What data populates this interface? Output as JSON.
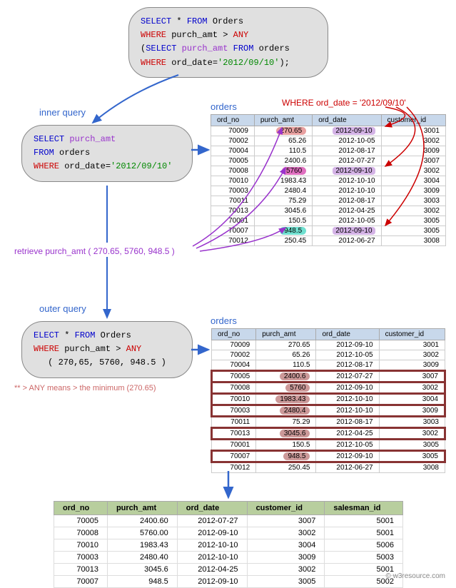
{
  "main_query": {
    "l1a": "SELECT",
    "l1b": " * ",
    "l1c": "FROM",
    "l1d": " Orders",
    "l2a": "WHERE",
    "l2b": " purch_amt > ",
    "l2c": "ANY",
    "l3a": "(",
    "l3b": "SELECT",
    "l3c": " purch_amt ",
    "l3d": "FROM",
    "l3e": " orders",
    "l4a": "WHERE  ",
    "l4b": "ord_date=",
    "l4c": "'2012/09/10'",
    "l4d": ");"
  },
  "inner_label": "inner query",
  "inner_query": {
    "l1a": "SELECT",
    "l1b": " purch_amt",
    "l2a": "FROM",
    "l2b": " orders",
    "l3a": "WHERE  ",
    "l3b": "ord_date=",
    "l3c": "'2012/09/10'"
  },
  "outer_label": "outer query",
  "outer_query": {
    "l1a": "ELECT",
    "l1b": " * ",
    "l1c": "FROM",
    "l1d": " Orders",
    "l2a": "WHERE",
    "l2b": " purch_amt > ",
    "l2c": "ANY",
    "l3a": "( 270,65, 5760, 948.5 )"
  },
  "where_note": "WHERE ord_date = '2012/09/10'",
  "retrieve_note": "retrieve purch_amt ( 270.65, 5760, 948.5 )",
  "any_note": "**   > ANY means > the minimum (270.65)",
  "table1_title": "orders",
  "table2_title": "orders",
  "cols4": [
    "ord_no",
    "purch_amt",
    "ord_date",
    "customer_id"
  ],
  "cols5": [
    "ord_no",
    "purch_amt",
    "ord_date",
    "customer_id",
    "salesman_id"
  ],
  "rows_source": [
    {
      "ord_no": "70009",
      "purch_amt": "270.65",
      "ord_date": "2012-09-10",
      "customer_id": "3001",
      "hl": "pink"
    },
    {
      "ord_no": "70002",
      "purch_amt": "65.26",
      "ord_date": "2012-10-05",
      "customer_id": "3002"
    },
    {
      "ord_no": "70004",
      "purch_amt": "110.5",
      "ord_date": "2012-08-17",
      "customer_id": "3009"
    },
    {
      "ord_no": "70005",
      "purch_amt": "2400.6",
      "ord_date": "2012-07-27",
      "customer_id": "3007"
    },
    {
      "ord_no": "70008",
      "purch_amt": "5760",
      "ord_date": "2012-09-10",
      "customer_id": "3002",
      "hl": "mag"
    },
    {
      "ord_no": "70010",
      "purch_amt": "1983.43",
      "ord_date": "2012-10-10",
      "customer_id": "3004"
    },
    {
      "ord_no": "70003",
      "purch_amt": "2480.4",
      "ord_date": "2012-10-10",
      "customer_id": "3009"
    },
    {
      "ord_no": "70011",
      "purch_amt": "75.29",
      "ord_date": "2012-08-17",
      "customer_id": "3003"
    },
    {
      "ord_no": "70013",
      "purch_amt": "3045.6",
      "ord_date": "2012-04-25",
      "customer_id": "3002"
    },
    {
      "ord_no": "70001",
      "purch_amt": "150.5",
      "ord_date": "2012-10-05",
      "customer_id": "3005"
    },
    {
      "ord_no": "70007",
      "purch_amt": "948.5",
      "ord_date": "2012-09-10",
      "customer_id": "3005",
      "hl": "cyan"
    },
    {
      "ord_no": "70012",
      "purch_amt": "250.45",
      "ord_date": "2012-06-27",
      "customer_id": "3008"
    }
  ],
  "rows_outer": [
    {
      "ord_no": "70009",
      "purch_amt": "270.65",
      "ord_date": "2012-09-10",
      "customer_id": "3001"
    },
    {
      "ord_no": "70002",
      "purch_amt": "65.26",
      "ord_date": "2012-10-05",
      "customer_id": "3002"
    },
    {
      "ord_no": "70004",
      "purch_amt": "110.5",
      "ord_date": "2012-08-17",
      "customer_id": "3009"
    },
    {
      "ord_no": "70005",
      "purch_amt": "2400.6",
      "ord_date": "2012-07-27",
      "customer_id": "3007",
      "sel": true
    },
    {
      "ord_no": "70008",
      "purch_amt": "5760",
      "ord_date": "2012-09-10",
      "customer_id": "3002",
      "sel": true
    },
    {
      "ord_no": "70010",
      "purch_amt": "1983.43",
      "ord_date": "2012-10-10",
      "customer_id": "3004",
      "sel": true
    },
    {
      "ord_no": "70003",
      "purch_amt": "2480.4",
      "ord_date": "2012-10-10",
      "customer_id": "3009",
      "sel": true
    },
    {
      "ord_no": "70011",
      "purch_amt": "75.29",
      "ord_date": "2012-08-17",
      "customer_id": "3003"
    },
    {
      "ord_no": "70013",
      "purch_amt": "3045.6",
      "ord_date": "2012-04-25",
      "customer_id": "3002",
      "sel": true
    },
    {
      "ord_no": "70001",
      "purch_amt": "150.5",
      "ord_date": "2012-10-05",
      "customer_id": "3005"
    },
    {
      "ord_no": "70007",
      "purch_amt": "948.5",
      "ord_date": "2012-09-10",
      "customer_id": "3005",
      "sel": true
    },
    {
      "ord_no": "70012",
      "purch_amt": "250.45",
      "ord_date": "2012-06-27",
      "customer_id": "3008"
    }
  ],
  "rows_result": [
    {
      "ord_no": "70005",
      "purch_amt": "2400.60",
      "ord_date": "2012-07-27",
      "customer_id": "3007",
      "salesman_id": "5001"
    },
    {
      "ord_no": "70008",
      "purch_amt": "5760.00",
      "ord_date": "2012-09-10",
      "customer_id": "3002",
      "salesman_id": "5001"
    },
    {
      "ord_no": "70010",
      "purch_amt": "1983.43",
      "ord_date": "2012-10-10",
      "customer_id": "3004",
      "salesman_id": "5006"
    },
    {
      "ord_no": "70003",
      "purch_amt": "2480.40",
      "ord_date": "2012-10-10",
      "customer_id": "3009",
      "salesman_id": "5003"
    },
    {
      "ord_no": "70013",
      "purch_amt": "3045.6",
      "ord_date": "2012-04-25",
      "customer_id": "3002",
      "salesman_id": "5001"
    },
    {
      "ord_no": "70007",
      "purch_amt": "948.5",
      "ord_date": "2012-09-10",
      "customer_id": "3005",
      "salesman_id": "5002"
    }
  ],
  "attribution": "© w3resource.com"
}
